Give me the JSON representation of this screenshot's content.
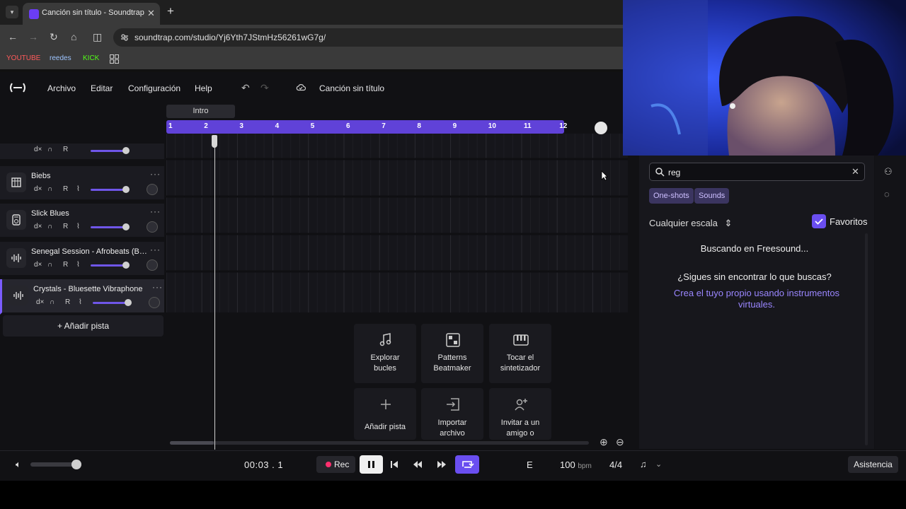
{
  "browser": {
    "tab_title": "Canción sin título - Soundtrap",
    "url": "soundtrap.com/studio/Yj6Yth7JStmHz56261wG7g/",
    "bookmarks": [
      {
        "label": "YOUTUBE",
        "color": "#ff5a5a"
      },
      {
        "label": "reedes",
        "color": "#9ec5ff"
      },
      {
        "label": "KICK",
        "color": "#53fc18"
      }
    ]
  },
  "menu": {
    "items": [
      "Archivo",
      "Editar",
      "Configuración",
      "Help"
    ],
    "song_title": "Canción sin título"
  },
  "timeline": {
    "section": "Intro",
    "bars": [
      "1",
      "2",
      "3",
      "4",
      "5",
      "6",
      "7",
      "8",
      "9",
      "10",
      "11",
      "12"
    ],
    "playhead_bar": 2.3
  },
  "tracks": [
    {
      "name": "Biebs",
      "icon": "grid-icon",
      "mute": "d×",
      "record": "R"
    },
    {
      "name": "Slick Blues",
      "icon": "drum-machine-icon",
      "mute": "d×",
      "record": "R"
    },
    {
      "name": "Senegal Session - Afrobeats (Br...",
      "icon": "waveform-icon",
      "mute": "d×",
      "record": "R"
    },
    {
      "name": "Crystals - Bluesette Vibraphone",
      "icon": "waveform-icon",
      "mute": "d×",
      "record": "R",
      "selected": true
    }
  ],
  "add_track_label": "+ Añadir pista",
  "tiles": [
    {
      "label": "Explorar bucles",
      "icon": "music-note-icon"
    },
    {
      "label": "Patterns Beatmaker",
      "icon": "beatmaker-icon"
    },
    {
      "label": "Tocar el sintetizador",
      "icon": "piano-icon"
    },
    {
      "label": "Añadir pista",
      "icon": "plus-icon"
    },
    {
      "label": "Importar archivo",
      "icon": "import-icon"
    },
    {
      "label": "Invitar a un amigo o",
      "icon": "invite-icon"
    }
  ],
  "loops_panel": {
    "search_value": "reg",
    "chips": [
      "One-shots",
      "Sounds"
    ],
    "scale_label": "Cualquier escala",
    "favorites_label": "Favoritos",
    "favorites_checked": true,
    "status": "Buscando en Freesound...",
    "not_found": "¿Sigues sin encontrar lo que buscas?",
    "create_link": "Crea el tuyo propio usando instrumentos virtuales."
  },
  "transport": {
    "time": "00:03 . 1",
    "rec_label": "Rec",
    "key": "E",
    "tempo": "100",
    "tempo_unit": "bpm",
    "signature": "4/4",
    "help_label": "Asistencia",
    "master_volume": 0.9
  },
  "colors": {
    "accent": "#6a4ef0",
    "ruler": "#6042d8",
    "rec": "#ff2f6e"
  }
}
